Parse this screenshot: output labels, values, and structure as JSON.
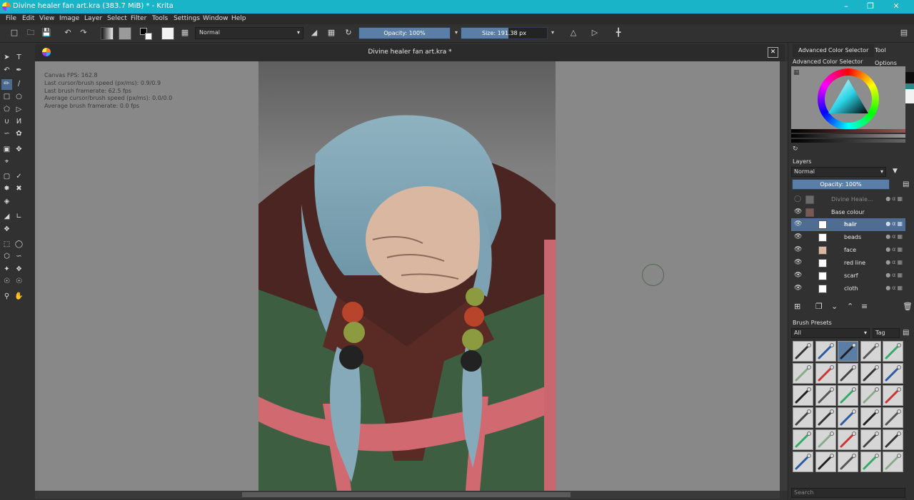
{
  "window": {
    "title": "Divine healer fan art.kra (383.7 MiB)  * - Krita",
    "controls": [
      "minimize-icon",
      "maximize-icon",
      "close-icon"
    ]
  },
  "menu": [
    "File",
    "Edit",
    "View",
    "Image",
    "Layer",
    "Select",
    "Filter",
    "Tools",
    "Settings",
    "Window",
    "Help"
  ],
  "toolbar": {
    "blend_mode": "Normal",
    "opacity": "Opacity: 100%",
    "size": "Size: 191.38 px"
  },
  "document": {
    "tab_title": "Divine healer fan art.kra *"
  },
  "hud": {
    "canvas_fps": "Canvas FPS: 162.8",
    "last_speed": "Last cursor/brush speed (px/ms): 0.9/0.9",
    "last_framerate": "Last brush framerate: 62.5 fps",
    "avg_speed": "Average cursor/brush speed (px/ms): 0.0/0.0",
    "avg_framerate": "Average brush framerate: 0.0 fps"
  },
  "dock": {
    "tabs": [
      "Advanced Color Selector",
      "Tool Options"
    ],
    "color_selector_title": "Advanced Color Selector",
    "layers_title": "Layers",
    "layers_blend": "Normal",
    "layers_opacity": "Opacity:  100%",
    "layers": [
      {
        "name": "Divine Heale...",
        "visible": false,
        "selected": false,
        "indent": 0
      },
      {
        "name": "Base colour",
        "visible": true,
        "selected": false,
        "indent": 0
      },
      {
        "name": "hair",
        "visible": true,
        "selected": true,
        "indent": 1
      },
      {
        "name": "beads",
        "visible": true,
        "selected": false,
        "indent": 1
      },
      {
        "name": "face",
        "visible": true,
        "selected": false,
        "indent": 1
      },
      {
        "name": "red line",
        "visible": true,
        "selected": false,
        "indent": 1
      },
      {
        "name": "scarf",
        "visible": true,
        "selected": false,
        "indent": 1
      },
      {
        "name": "cloth",
        "visible": true,
        "selected": false,
        "indent": 1
      }
    ],
    "brush_presets_title": "Brush Presets",
    "brush_filter": "All",
    "brush_tag": "Tag",
    "search_placeholder": "Search"
  },
  "colors": {
    "titlebar": "#1ab4c8",
    "accent": "#4a6b8f",
    "selected_layer": "#4f6d92"
  }
}
